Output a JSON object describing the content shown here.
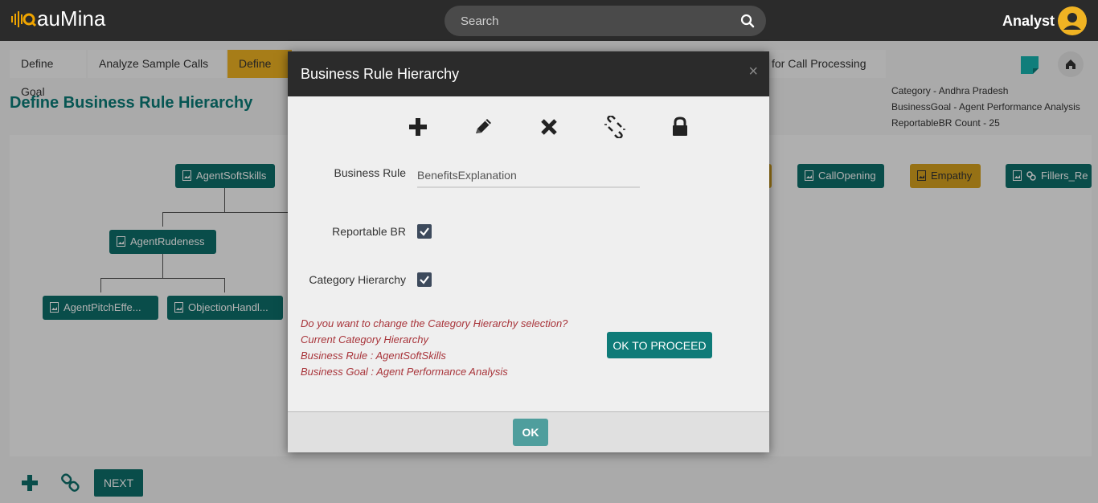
{
  "app": {
    "logo_text": "auMina",
    "user_label": "Analyst"
  },
  "search": {
    "placeholder": "Search"
  },
  "breadcrumbs": [
    "Define Goal",
    "Analyze Sample Calls",
    "Define",
    "for Call Processing"
  ],
  "page": {
    "title": "Define Business Rule Hierarchy",
    "info": [
      "Category - Andhra Pradesh",
      "BusinessGoal - Agent Performance Analysis",
      "ReportableBR Count - 25"
    ]
  },
  "tree_nodes": {
    "root": "AgentSoftSkills",
    "child": "AgentRudeness",
    "leaf1": "AgentPitchEffe...",
    "leaf2": "ObjectionHandl...",
    "right1": "CallOpening",
    "right2": "Empathy",
    "right3": "Fillers_Re"
  },
  "bottom": {
    "next_label": "NEXT"
  },
  "modal": {
    "title": "Business Rule Hierarchy",
    "close": "×",
    "toolbar_icons": [
      "plus-icon",
      "pencil-icon",
      "delete-icon",
      "unlink-icon",
      "lock-icon"
    ],
    "business_rule_label": "Business Rule",
    "business_rule_value": "BenefitsExplanation",
    "reportable_label": "Reportable BR",
    "reportable_checked": true,
    "category_label": "Category Hierarchy",
    "category_checked": true,
    "messages": [
      "Do you want to change the Category Hierarchy selection?",
      "Current Category Hierarchy",
      "Business Rule : AgentSoftSkills",
      "Business Goal : Agent Performance Analysis"
    ],
    "proceed_label": "OK TO PROCEED",
    "ok_label": "OK"
  },
  "colors": {
    "accent": "#0e7b78",
    "gold": "#f0b323",
    "message": "#a8343a"
  }
}
